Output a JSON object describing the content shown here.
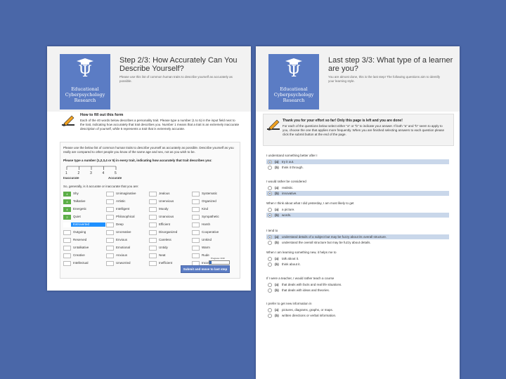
{
  "left": {
    "logo_text": "Educational Cyberpsychology Research",
    "title": "Step 2/3: How Accurately Can You Describe Yourself?",
    "subtitle": "Please use this list of common human traits to describe yourself as accurately as possible.",
    "howto_title": "How to fill out this form",
    "howto_text": "Each of the 40 words below describes a personality trait. Please type a number (1 to 5) in the input field next to the trait, indicating how accurately that trait describes you. Number 1 means that a trait is an extremely inaccurate description of yourself, while 5 represents a trait that is extremely accurate.",
    "instructions": "Please use the below list of common human traits to describe yourself as accurately as possible. Describe yourself as you really are compared to other people you know of the same age and sex, not as you wish to be.",
    "type_prompt": "Please type a number (1,2,3,4 or 5) in every trait, indicating how accurately that trait describes you:",
    "scale_numbers": [
      "1",
      "2",
      "3",
      "4",
      "5"
    ],
    "scale_low": "Inaccurate",
    "scale_high": "Accurate",
    "question": "So, generally, is it accurate or inaccurate that you are:",
    "traits": [
      {
        "label": "Shy",
        "value": "4"
      },
      {
        "label": "Talkative",
        "value": "4"
      },
      {
        "label": "Energetic",
        "value": "4"
      },
      {
        "label": "Quiet",
        "value": "2"
      },
      {
        "label": "Extroverted",
        "value": ""
      },
      {
        "label": "Outgoing",
        "value": ""
      },
      {
        "label": "Reserved",
        "value": ""
      },
      {
        "label": "Untalkative",
        "value": ""
      },
      {
        "label": "Creative",
        "value": ""
      },
      {
        "label": "Intellectual",
        "value": ""
      },
      {
        "label": "Unimaginative",
        "value": ""
      },
      {
        "label": "Artistic",
        "value": ""
      },
      {
        "label": "Intelligent",
        "value": ""
      },
      {
        "label": "Philosophical",
        "value": ""
      },
      {
        "label": "Deep",
        "value": ""
      },
      {
        "label": "Uncreative",
        "value": ""
      },
      {
        "label": "Envious",
        "value": ""
      },
      {
        "label": "Emotional",
        "value": ""
      },
      {
        "label": "Anxious",
        "value": ""
      },
      {
        "label": "Unworried",
        "value": ""
      },
      {
        "label": "Jealous",
        "value": ""
      },
      {
        "label": "Unenvious",
        "value": ""
      },
      {
        "label": "Moody",
        "value": ""
      },
      {
        "label": "Unanxious",
        "value": ""
      },
      {
        "label": "Efficient",
        "value": ""
      },
      {
        "label": "Disorganized",
        "value": ""
      },
      {
        "label": "Careless",
        "value": ""
      },
      {
        "label": "Untidy",
        "value": ""
      },
      {
        "label": "Neat",
        "value": ""
      },
      {
        "label": "Inefficient",
        "value": ""
      },
      {
        "label": "Systematic",
        "value": ""
      },
      {
        "label": "Organized",
        "value": ""
      },
      {
        "label": "Kind",
        "value": ""
      },
      {
        "label": "Sympathetic",
        "value": ""
      },
      {
        "label": "Harsh",
        "value": ""
      },
      {
        "label": "Cooperative",
        "value": ""
      },
      {
        "label": "Unkind",
        "value": ""
      },
      {
        "label": "Warm",
        "value": ""
      },
      {
        "label": "Rude",
        "value": ""
      },
      {
        "label": "Inconsiderate",
        "value": ""
      }
    ],
    "selected_trait": "Extroverted",
    "progress_label": "Progress: 4/40",
    "progress_fraction": 0.1,
    "submit_label": "Submit and move to last step"
  },
  "right": {
    "logo_text": "Educational Cyberpsychology Research",
    "title": "Last step 3/3: What type of a learner are you?",
    "subtitle": "You are almost done, this is the last step! The following questions aim to identify your learning style.",
    "notice_title": "Thank you for your effort so far! Only this page is left and you are done!",
    "notice_text": "For each of the questions below select either \"a\" or \"b\" to indicate your answer. If both \"a\" and \"b\" seem to apply to you, choose the one that applies more frequently. When you are finished selecting answers to each question please click the submit button at the end of the page.",
    "questions": [
      {
        "text": "I understand something better after I",
        "options": [
          {
            "letter": "(a)",
            "text": "try it out.",
            "selected": true
          },
          {
            "letter": "(b)",
            "text": "think it through.",
            "selected": false
          }
        ]
      },
      {
        "text": "I would rather be considered",
        "options": [
          {
            "letter": "(a)",
            "text": "realistic.",
            "selected": false
          },
          {
            "letter": "(b)",
            "text": "innovative.",
            "selected": true
          }
        ]
      },
      {
        "text": "When I think about what I did yesterday, I am most likely to get",
        "options": [
          {
            "letter": "(a)",
            "text": "a picture.",
            "selected": false
          },
          {
            "letter": "(b)",
            "text": "words.",
            "selected": true
          }
        ]
      },
      {
        "text": "I tend to",
        "options": [
          {
            "letter": "(a)",
            "text": "understand details of a subject but may be fuzzy about its overall structure.",
            "selected": true
          },
          {
            "letter": "(b)",
            "text": "understand the overall structure but may be fuzzy about details.",
            "selected": false
          }
        ]
      },
      {
        "text": "When I am learning something new, it helps me to",
        "options": [
          {
            "letter": "(a)",
            "text": "talk about it.",
            "selected": false
          },
          {
            "letter": "(b)",
            "text": "think about it.",
            "selected": false
          }
        ]
      },
      {
        "text": "If I were a teacher, I would rather teach a course",
        "options": [
          {
            "letter": "(a)",
            "text": "that deals with facts and real life situations.",
            "selected": false
          },
          {
            "letter": "(b)",
            "text": "that deals with ideas and theories.",
            "selected": false
          }
        ]
      },
      {
        "text": "I prefer to get new information in",
        "options": [
          {
            "letter": "(a)",
            "text": "pictures, diagrams, graphs, or maps.",
            "selected": false
          },
          {
            "letter": "(b)",
            "text": "written directions or verbal information.",
            "selected": false
          }
        ]
      }
    ]
  },
  "colors": {
    "background": "#4a67a8",
    "accent": "#5b7cc4",
    "filled_box": "#5cae47",
    "selection": "#c9d7ea",
    "highlight": "#1e90ff"
  }
}
